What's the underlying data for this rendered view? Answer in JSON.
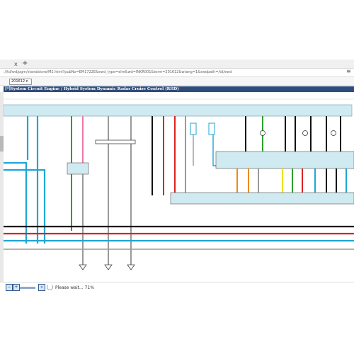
{
  "browser": {
    "url": "://td/wd/pgm/standalone/M2.html?pubNo=EM1722E&ewd_type=elm&wd=INKR001&term=201612&wtang=1&swdpath=/td/ewd",
    "tab_close_glyph": "x",
    "new_tab_glyph": "+",
    "menu_glyph": "≡"
  },
  "toolbar": {
    "version_select": "201612"
  },
  "diagram": {
    "title": "[*]System Circuit  Engine / Hybrid System  Dynamic Radar Cruise Control (RHD)"
  },
  "footer": {
    "zoom_out_glyph": "−",
    "zoom_in_glyph": "+",
    "status_text": "Please wait... 71%"
  },
  "colors": {
    "wire_blue": "#1ea6d6",
    "wire_red": "#dd2222",
    "wire_black": "#111111",
    "wire_green": "#2ca02c",
    "wire_pink": "#f07aa8",
    "wire_gray": "#9a9a9a",
    "wire_orange": "#f08a1a",
    "wire_yellow": "#f0e21a",
    "bus_fill": "#cfeaf1",
    "title_bar": "#2f4d7a"
  }
}
